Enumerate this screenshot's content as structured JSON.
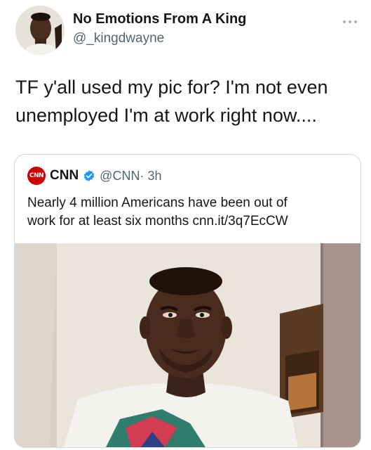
{
  "author": {
    "display_name": "No Emotions From A King",
    "handle": "@_kingdwayne"
  },
  "tweet": {
    "text_line1": "TF y'all used my pic for? I'm not even",
    "text_line2": "unemployed I'm at work right now...."
  },
  "quoted_tweet": {
    "logo_text": "CNN",
    "name": "CNN",
    "handle": "@CNN",
    "time": "· 3h",
    "text_line1": "Nearly 4 million Americans have been out of",
    "text_line2": "work for at least six months cnn.it/3q7EcCW"
  },
  "colors": {
    "text": "#14171a",
    "secondary_text": "#536471",
    "verified": "#1d9bf0",
    "cnn_red": "#cc0000",
    "border": "#cfd9de"
  },
  "icons": {
    "more": "more-horizontal-icon",
    "verified": "verified-badge-icon"
  }
}
